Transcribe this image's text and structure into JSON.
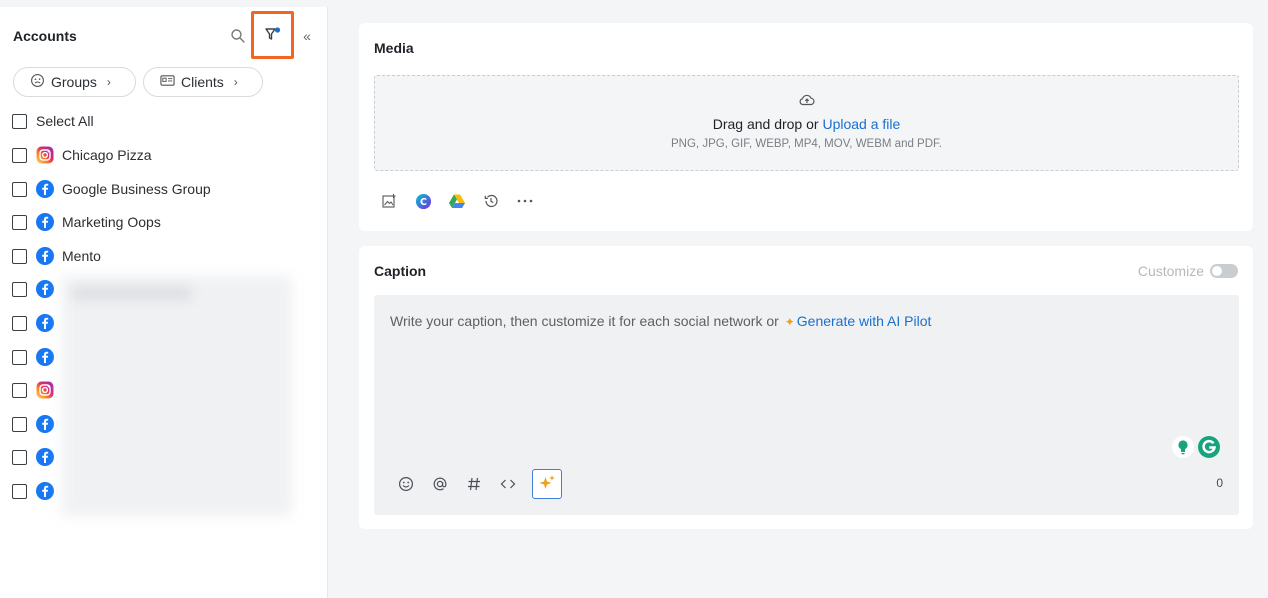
{
  "sidebar": {
    "title": "Accounts",
    "groups_label": "Groups",
    "clients_label": "Clients",
    "select_all_label": "Select All",
    "accounts": [
      {
        "label": "Chicago Pizza",
        "network": "instagram"
      },
      {
        "label": "Google Business Group",
        "network": "facebook"
      },
      {
        "label": "Marketing Oops",
        "network": "facebook"
      },
      {
        "label": "Mento",
        "network": "facebook"
      },
      {
        "label": "",
        "network": "facebook"
      },
      {
        "label": "",
        "network": "facebook"
      },
      {
        "label": "",
        "network": "facebook"
      },
      {
        "label": "",
        "network": "instagram"
      },
      {
        "label": "",
        "network": "facebook"
      },
      {
        "label": "",
        "network": "facebook"
      },
      {
        "label": "",
        "network": "facebook"
      }
    ]
  },
  "media": {
    "title": "Media",
    "drop_text": "Drag and drop or ",
    "upload_link": "Upload a file",
    "formats": "PNG, JPG, GIF, WEBP, MP4, MOV, WEBM and PDF.",
    "tools": [
      "image-add-icon",
      "canva-icon",
      "google-drive-icon",
      "history-icon",
      "more-icon"
    ]
  },
  "caption": {
    "title": "Caption",
    "customize_label": "Customize",
    "placeholder": "Write your caption, then customize it for each social network or ",
    "ai_link": "Generate with AI Pilot",
    "char_count": "0",
    "tools": [
      "emoji-icon",
      "mention-icon",
      "hashtag-icon",
      "code-icon",
      "ai-sparkle-icon"
    ]
  },
  "colors": {
    "accent": "#1a6fd1",
    "highlight": "#f26522",
    "facebook": "#1877f2",
    "ai_sparkle": "#f0a11b"
  }
}
